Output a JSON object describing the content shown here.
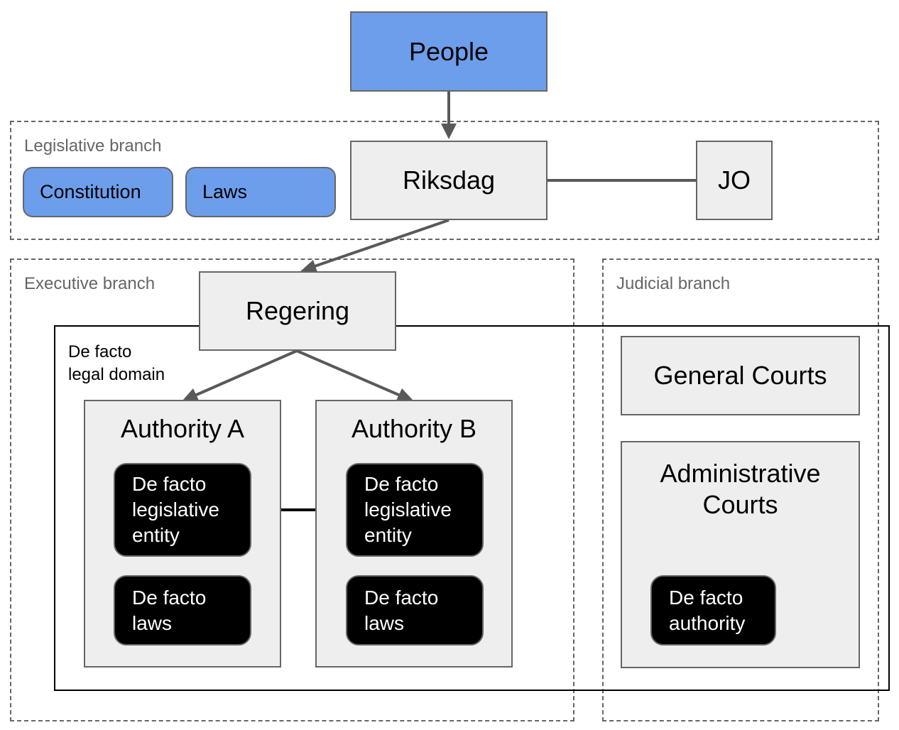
{
  "diagram": {
    "nodes": {
      "people": "People",
      "riksdag": "Riksdag",
      "jo": "JO",
      "constitution": "Constitution",
      "laws": "Laws",
      "regering": "Regering",
      "authority_a": "Authority A",
      "authority_b": "Authority B",
      "a_legislative_entity": "De facto\nlegislative\nentity",
      "a_laws": "De facto\nlaws",
      "b_legislative_entity": "De facto\nlegislative\nentity",
      "b_laws": "De facto\nlaws",
      "general_courts": "General Courts",
      "administrative_courts": "Administrative\nCourts",
      "de_facto_authority": "De facto\nauthority"
    },
    "groups": {
      "legislative": "Legislative branch",
      "executive": "Executive branch",
      "judicial": "Judicial branch",
      "legal_domain": "De facto\nlegal domain"
    },
    "edges": [
      {
        "from": "People",
        "to": "Riksdag",
        "type": "arrow"
      },
      {
        "from": "Riksdag",
        "to": "JO",
        "type": "line"
      },
      {
        "from": "Riksdag",
        "to": "Regering",
        "type": "arrow"
      },
      {
        "from": "Regering",
        "to": "Authority A",
        "type": "arrow"
      },
      {
        "from": "Regering",
        "to": "Authority B",
        "type": "arrow"
      },
      {
        "from": "Authority A legislative entity",
        "to": "Authority B legislative entity",
        "type": "bidirectional-arrow"
      }
    ],
    "colors": {
      "blue_fill": "#6d9eeb",
      "gray_fill": "#eeeeee",
      "black_fill": "#000000",
      "border_gray": "#666666",
      "label_gray": "#666666"
    }
  }
}
